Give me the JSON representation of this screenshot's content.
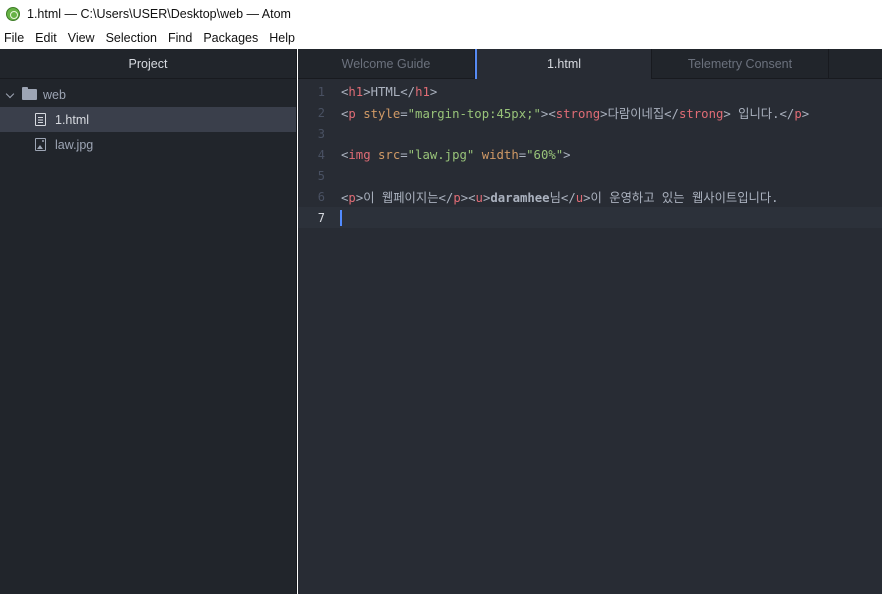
{
  "window": {
    "title": "1.html — C:\\Users\\USER\\Desktop\\web — Atom"
  },
  "menu": [
    "File",
    "Edit",
    "View",
    "Selection",
    "Find",
    "Packages",
    "Help"
  ],
  "sidebar": {
    "title": "Project",
    "root": "web",
    "files": [
      {
        "name": "1.html",
        "icon": "text-file-icon",
        "selected": true
      },
      {
        "name": "law.jpg",
        "icon": "image-file-icon",
        "selected": false
      }
    ]
  },
  "tabs": [
    {
      "label": "Welcome Guide",
      "active": false
    },
    {
      "label": "1.html",
      "active": true
    },
    {
      "label": "Telemetry Consent",
      "active": false
    },
    {
      "label": "",
      "active": false
    }
  ],
  "editor": {
    "current_line": 7,
    "lines": [
      {
        "n": "1",
        "tokens": [
          [
            "t-punc",
            "<"
          ],
          [
            "t-tag",
            "h1"
          ],
          [
            "t-punc",
            ">"
          ],
          [
            "t-txt",
            "HTML"
          ],
          [
            "t-punc",
            "</"
          ],
          [
            "t-tag",
            "h1"
          ],
          [
            "t-punc",
            ">"
          ]
        ]
      },
      {
        "n": "2",
        "tokens": [
          [
            "t-punc",
            "<"
          ],
          [
            "t-tag",
            "p"
          ],
          [
            "t-txt",
            " "
          ],
          [
            "t-attr",
            "style"
          ],
          [
            "t-punc",
            "="
          ],
          [
            "t-str",
            "\"margin-top:45px;\""
          ],
          [
            "t-punc",
            ">"
          ],
          [
            "t-punc",
            "<"
          ],
          [
            "t-tag",
            "strong"
          ],
          [
            "t-punc",
            ">"
          ],
          [
            "t-txt",
            "다람이네집"
          ],
          [
            "t-punc",
            "</"
          ],
          [
            "t-tag",
            "strong"
          ],
          [
            "t-punc",
            ">"
          ],
          [
            "t-txt",
            " 입니다."
          ],
          [
            "t-punc",
            "</"
          ],
          [
            "t-tag",
            "p"
          ],
          [
            "t-punc",
            ">"
          ]
        ]
      },
      {
        "n": "3",
        "tokens": []
      },
      {
        "n": "4",
        "tokens": [
          [
            "t-punc",
            "<"
          ],
          [
            "t-tag",
            "img"
          ],
          [
            "t-txt",
            " "
          ],
          [
            "t-attr",
            "src"
          ],
          [
            "t-punc",
            "="
          ],
          [
            "t-str",
            "\"law.jpg\""
          ],
          [
            "t-txt",
            " "
          ],
          [
            "t-attr",
            "width"
          ],
          [
            "t-punc",
            "="
          ],
          [
            "t-str",
            "\"60%\""
          ],
          [
            "t-punc",
            ">"
          ]
        ]
      },
      {
        "n": "5",
        "tokens": []
      },
      {
        "n": "6",
        "tokens": [
          [
            "t-punc",
            "<"
          ],
          [
            "t-tag",
            "p"
          ],
          [
            "t-punc",
            ">"
          ],
          [
            "t-txt",
            "이 웹페이지는"
          ],
          [
            "t-punc",
            "</"
          ],
          [
            "t-tag",
            "p"
          ],
          [
            "t-punc",
            ">"
          ],
          [
            "t-punc",
            "<"
          ],
          [
            "t-tag",
            "u"
          ],
          [
            "t-punc",
            ">"
          ],
          [
            "t-txt t-bold",
            "daramhee"
          ],
          [
            "t-txt",
            "님"
          ],
          [
            "t-punc",
            "</"
          ],
          [
            "t-tag",
            "u"
          ],
          [
            "t-punc",
            ">"
          ],
          [
            "t-txt",
            "이 운영하고 있는 웹사이트입니다."
          ]
        ]
      },
      {
        "n": "7",
        "tokens": []
      }
    ]
  },
  "colors": {
    "sidebar_bg": "#21252b",
    "editor_bg": "#282c34",
    "accent": "#568af2",
    "tag": "#e06c75",
    "attr": "#d19a66",
    "string": "#98c379"
  }
}
